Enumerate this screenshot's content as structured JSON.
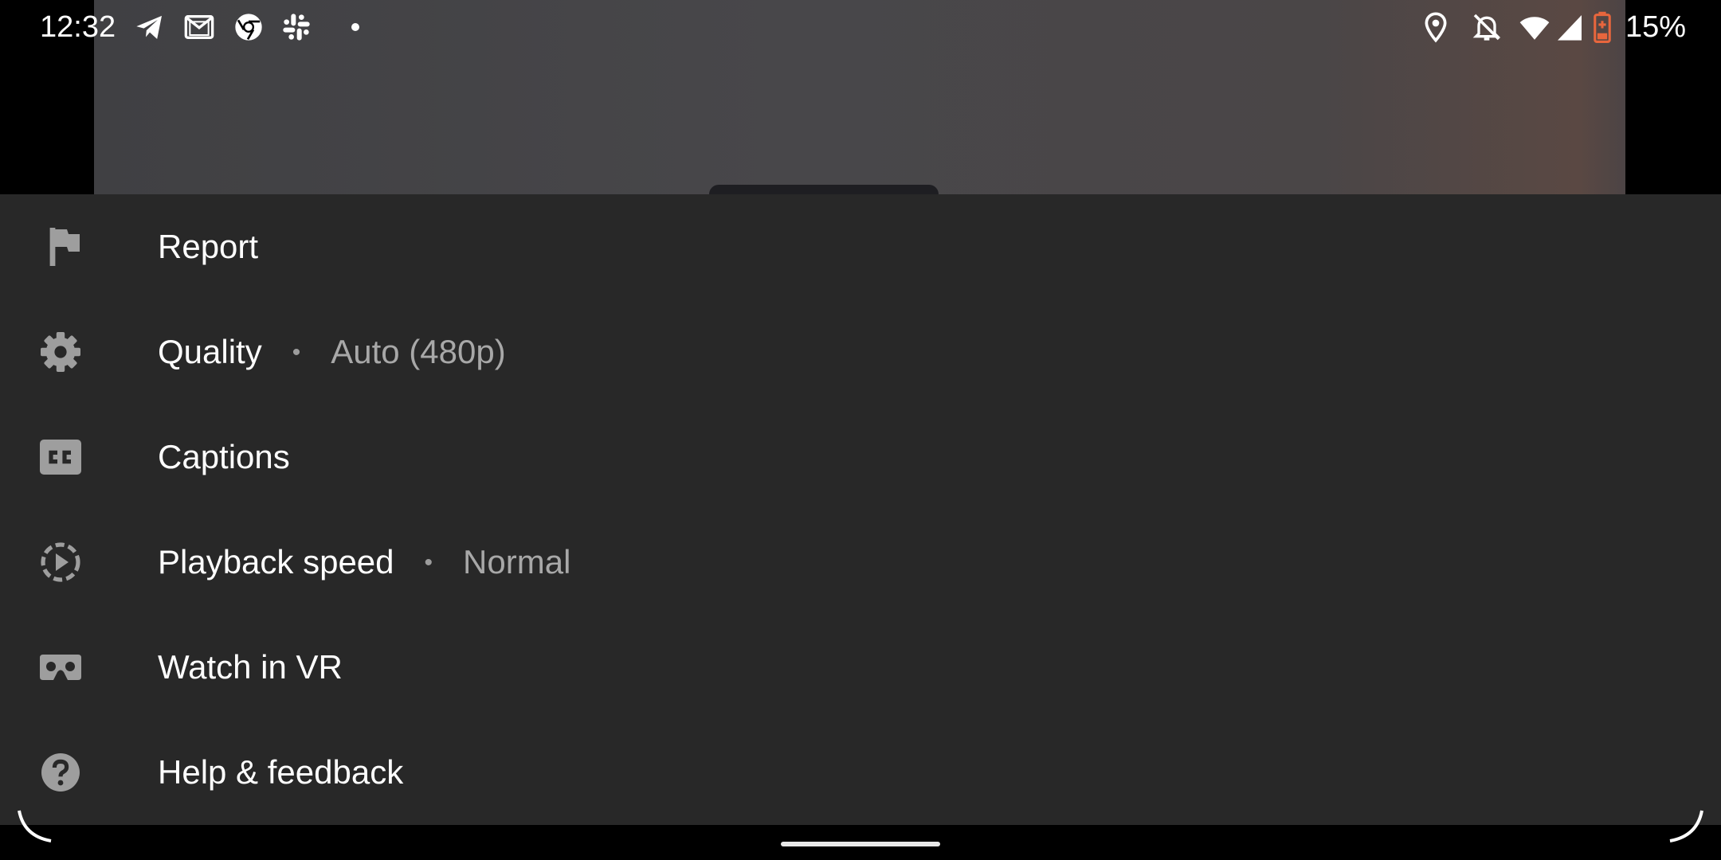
{
  "status_bar": {
    "time": "12:32",
    "battery_percent": "15%",
    "notification_icons": [
      "telegram-icon",
      "gmail-icon",
      "chrome-icon",
      "slack-icon",
      "more-dot-icon"
    ],
    "system_icons": [
      "location-icon",
      "notifications-off-icon",
      "wifi-icon",
      "cell-signal-icon",
      "battery-low-icon"
    ],
    "battery_color": "#e8663d"
  },
  "menu": {
    "items": [
      {
        "icon": "flag-icon",
        "label": "Report",
        "value": ""
      },
      {
        "icon": "gear-icon",
        "label": "Quality",
        "value": "Auto (480p)"
      },
      {
        "icon": "closed-captions-icon",
        "label": "Captions",
        "value": ""
      },
      {
        "icon": "playback-speed-icon",
        "label": "Playback speed",
        "value": "Normal"
      },
      {
        "icon": "vr-headset-icon",
        "label": "Watch in VR",
        "value": ""
      },
      {
        "icon": "help-icon",
        "label": "Help & feedback",
        "value": ""
      }
    ],
    "separator": "•",
    "background": "#282828",
    "icon_color": "#9e9e9e"
  }
}
